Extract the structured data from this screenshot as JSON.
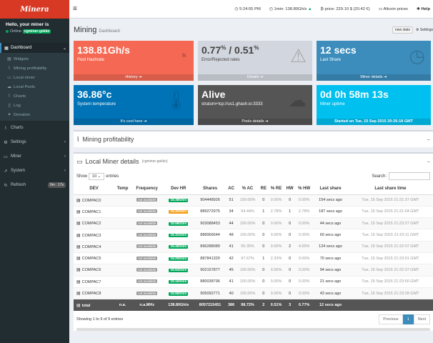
{
  "app": {
    "logo": "Minera"
  },
  "user": {
    "hello": "Hello, your miner is",
    "status": "Online",
    "miner_name": "cgminer-gekko"
  },
  "sidebar": {
    "dashboard": "Dashboard",
    "sub_items": [
      {
        "label": "Widgets",
        "icon": "widgets-icon"
      },
      {
        "label": "Mining profitability",
        "icon": "chart-icon"
      },
      {
        "label": "Local miner",
        "icon": "desktop-icon"
      },
      {
        "label": "Local Pools",
        "icon": "cloud-icon"
      },
      {
        "label": "Charts",
        "icon": "chart-icon"
      },
      {
        "label": "Log",
        "icon": "file-icon"
      },
      {
        "label": "Donation",
        "icon": "gift-icon"
      }
    ],
    "charts": "Charts",
    "settings": "Settings",
    "miner": "Miner",
    "system": "System",
    "refresh": "Refresh",
    "refresh_badge": "0m : 17s"
  },
  "topbar": {
    "time": "5:24:55 PM",
    "hashrate": "1min: 138.80Gh/s",
    "price": "price: 229.10 $ (20.42 €)",
    "altcoin": "Altcoin prices",
    "help": "Help"
  },
  "header": {
    "title": "Mining",
    "subtitle": "Dashboard",
    "new_stats": "new stats",
    "settings": "Settings"
  },
  "tiles": [
    {
      "value": "138.81Gh/s",
      "label": "Pool Hashrate",
      "footer": "History",
      "color": "#f56954",
      "icon": "dashboard-gauge-icon"
    },
    {
      "value": "0.77",
      "value2": "0.51",
      "unit": "%",
      "label": "Error/Rejected rates",
      "footer": "Details",
      "color": "#d2d6de",
      "icon": "warning-icon"
    },
    {
      "value": "12 secs",
      "label": "Last Share",
      "footer": "Miner details",
      "color": "#3c8dbc",
      "icon": "clock-icon"
    },
    {
      "value": "36.86°c",
      "label": "System temperature",
      "footer": "It's cool here",
      "color": "#0073b7",
      "icon": "thermometer-icon"
    },
    {
      "value": "Alive",
      "label": "stratum+tcp://us1.ghash.io:3333",
      "footer": "Pools details",
      "color": "#555555",
      "icon": "cloud-upload-icon"
    },
    {
      "value": "0d 0h 58m 13s",
      "label": "Miner uptime",
      "footer": "Started on Tue, 15 Sep 2015 20:26:18 GMT",
      "color": "#00c0ef",
      "icon": "clock-icon"
    }
  ],
  "profit": {
    "title": "Mining profitability"
  },
  "miner_box": {
    "title": "Local Miner details",
    "subtitle": "(cgminer-gekko)"
  },
  "table": {
    "show": "Show",
    "show_value": "10",
    "entries": "entries",
    "search": "Search:",
    "headers": [
      "DEV",
      "Temp",
      "Frequency",
      "Dev HR",
      "Shares",
      "AC",
      "% AC",
      "RE",
      "% RE",
      "HW",
      "% HW",
      "Last share",
      "Last share time"
    ],
    "rows": [
      {
        "dev": "COMPAC0",
        "temp": "",
        "freq": "not available",
        "hr": "15.38Gh/s",
        "hr_color": "green",
        "shares": "904448926",
        "ac": "51",
        "pac": "100.00%",
        "re": "0",
        "pre": "0.00%",
        "hw": "0",
        "phw": "0.00%",
        "last": "154 secs ago",
        "time": "Tue, 15 Sep 2015 21:21:37 GMT"
      },
      {
        "dev": "COMPAC1",
        "temp": "",
        "freq": "not available",
        "hr": "15.32Gh/s",
        "hr_color": "orange",
        "shares": "889272975",
        "ac": "34",
        "pac": "94.44%",
        "re": "1",
        "pre": "2.78%",
        "hw": "1",
        "phw": "2.78%",
        "last": "187 secs ago",
        "time": "Tue, 15 Sep 2015 21:21:04 GMT"
      },
      {
        "dev": "COMPAC2",
        "temp": "",
        "freq": "not available",
        "hr": "15.58Gh/s",
        "hr_color": "green",
        "shares": "903088453",
        "ac": "44",
        "pac": "100.00%",
        "re": "0",
        "pre": "0.00%",
        "hw": "0",
        "phw": "0.00%",
        "last": "44 secs ago",
        "time": "Tue, 15 Sep 2015 21:23:27 GMT"
      },
      {
        "dev": "COMPAC3",
        "temp": "",
        "freq": "not available",
        "hr": "15.31Gh/s",
        "hr_color": "green",
        "shares": "888966644",
        "ac": "48",
        "pac": "100.00%",
        "re": "0",
        "pre": "0.00%",
        "hw": "0",
        "phw": "0.00%",
        "last": "60 secs ago",
        "time": "Tue, 15 Sep 2015 21:23:11 GMT"
      },
      {
        "dev": "COMPAC4",
        "temp": "",
        "freq": "not available",
        "hr": "15.46Gh/s",
        "hr_color": "green",
        "shares": "896288089",
        "ac": "41",
        "pac": "95.35%",
        "re": "0",
        "pre": "0.00%",
        "hw": "2",
        "phw": "4.65%",
        "last": "124 secs ago",
        "time": "Tue, 15 Sep 2015 21:22:07 GMT"
      },
      {
        "dev": "COMPAC5",
        "temp": "",
        "freq": "not available",
        "hr": "15.29Gh/s",
        "hr_color": "green",
        "shares": "887841320",
        "ac": "42",
        "pac": "97.67%",
        "re": "1",
        "pre": "2.33%",
        "hw": "0",
        "phw": "0.00%",
        "last": "70 secs ago",
        "time": "Tue, 15 Sep 2015 21:23:01 GMT"
      },
      {
        "dev": "COMPAC6",
        "temp": "",
        "freq": "not available",
        "hr": "15.54Gh/s",
        "hr_color": "green",
        "shares": "902157877",
        "ac": "45",
        "pac": "100.00%",
        "re": "0",
        "pre": "0.00%",
        "hw": "0",
        "phw": "0.00%",
        "last": "94 secs ago",
        "time": "Tue, 15 Sep 2015 21:22:37 GMT"
      },
      {
        "dev": "COMPAC7",
        "temp": "",
        "freq": "not available",
        "hr": "15.16Gh/s",
        "hr_color": "green",
        "shares": "880038796",
        "ac": "41",
        "pac": "100.00%",
        "re": "0",
        "pre": "0.00%",
        "hw": "0",
        "phw": "0.00%",
        "last": "21 secs ago",
        "time": "Tue, 15 Sep 2015 21:23:50 GMT"
      },
      {
        "dev": "COMPAC8",
        "temp": "",
        "freq": "not available",
        "hr": "15.59Gh/s",
        "hr_color": "green",
        "shares": "905092771",
        "ac": "40",
        "pac": "100.00%",
        "re": "0",
        "pre": "0.00%",
        "hw": "0",
        "phw": "0.00%",
        "last": "43 secs ago",
        "time": "Tue, 15 Sep 2015 21:23:28 GMT"
      }
    ],
    "total": {
      "dev": "total",
      "temp": "n.a.",
      "freq": "n.a.MHz",
      "hr": "138.80Gh/s",
      "shares": "8057215451",
      "ac": "386",
      "pac": "98.72%",
      "re": "2",
      "pre": "0.51%",
      "hw": "3",
      "phw": "0.77%",
      "last": "12 secs ago",
      "time": ""
    },
    "info": "Showing 1 to 9 of 9 entries",
    "prev": "Previous",
    "page": "1",
    "next": "Next"
  }
}
